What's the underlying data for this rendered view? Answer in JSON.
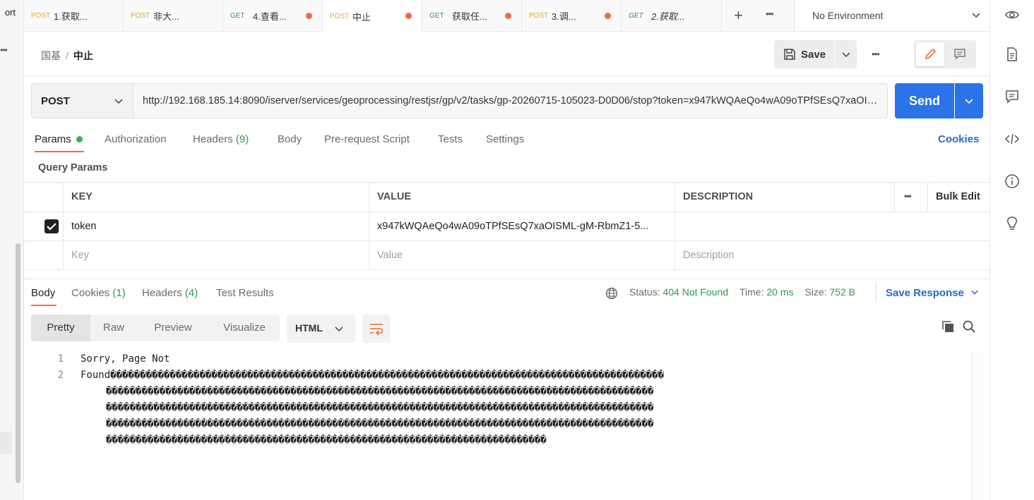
{
  "left_panel": {
    "port_text": "ort",
    "more_icon": "more-icon"
  },
  "tabs": [
    {
      "method": "POST",
      "title": "1.获取...",
      "dirty": false,
      "italic": false
    },
    {
      "method": "POST",
      "title": "非大...",
      "dirty": false,
      "italic": false
    },
    {
      "method": "GET",
      "title": "4.查看...",
      "dirty": true,
      "italic": false
    },
    {
      "method": "POST",
      "title": "中止",
      "dirty": true,
      "italic": false,
      "active": true
    },
    {
      "method": "GET",
      "title": "获取任...",
      "dirty": true,
      "italic": false
    },
    {
      "method": "POST",
      "title": "3.调...",
      "dirty": true,
      "italic": false
    },
    {
      "method": "GET",
      "title": "2.获取...",
      "dirty": false,
      "italic": true
    }
  ],
  "environment": {
    "label": "No Environment"
  },
  "header": {
    "breadcrumb_parent": "国基",
    "breadcrumb_sep": "/",
    "breadcrumb_current": "中止",
    "save_label": "Save"
  },
  "request": {
    "method": "POST",
    "url": "http://192.168.185.14:8090/iserver/services/geoprocessing/restjsr/gp/v2/tasks/gp-20260715-105023-D0D06/stop?token=x947kWQAeQo4wA09oTPfSEsQ7xaOISML-gM-RbmZ1-5...",
    "send_label": "Send"
  },
  "request_tabs": {
    "params": "Params",
    "authorization": "Authorization",
    "headers": "Headers",
    "headers_count": "(9)",
    "body": "Body",
    "prerequest": "Pre-request Script",
    "tests": "Tests",
    "settings": "Settings",
    "cookies": "Cookies"
  },
  "query_params": {
    "title": "Query Params",
    "columns": {
      "key": "KEY",
      "value": "VALUE",
      "description": "DESCRIPTION",
      "bulk_edit": "Bulk Edit"
    },
    "rows": [
      {
        "checked": true,
        "key": "token",
        "value": "x947kWQAeQo4wA09oTPfSEsQ7xaOISML-gM-RbmZ1-5...",
        "description": ""
      }
    ],
    "placeholders": {
      "key": "Key",
      "value": "Value",
      "description": "Description"
    }
  },
  "response": {
    "tabs": {
      "body": "Body",
      "cookies": "Cookies",
      "cookies_count": "(1)",
      "headers": "Headers",
      "headers_count": "(4)",
      "test_results": "Test Results"
    },
    "status_label": "Status:",
    "status_value": "404 Not Found",
    "time_label": "Time:",
    "time_value": "20 ms",
    "size_label": "Size:",
    "size_value": "752 B",
    "save_response": "Save Response",
    "view_modes": [
      "Pretty",
      "Raw",
      "Preview",
      "Visualize"
    ],
    "language": "HTML",
    "lines": [
      {
        "num": "1",
        "text": "Sorry, Page Not"
      },
      {
        "num": "2",
        "text": "Found���������������������������������������������������������������������������������������������"
      }
    ],
    "wrapped": [
      "��������������������������������������������������������������������������������������������",
      "��������������������������������������������������������������������������������������������",
      "��������������������������������������������������������������������������������������������",
      "��������������������������������������������������������������������������"
    ]
  },
  "colors": {
    "accent": "#f26b3a",
    "primary": "#2a73e8",
    "post": "#e7a72c",
    "get": "#2f9a52",
    "status_ok": "#2f9a52"
  }
}
